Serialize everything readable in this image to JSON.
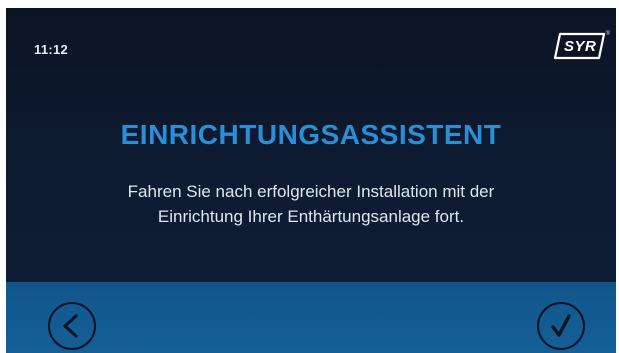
{
  "status_bar": {
    "time": "11:12",
    "logo_text": "SYR",
    "logo_mark": "®"
  },
  "wizard": {
    "title": "EINRICHTUNGSASSISTENT",
    "message_line1": "Fahren Sie nach erfolgreicher Installation mit der",
    "message_line2": "Einrichtung Ihrer Enthärtungsanlage fort."
  },
  "footer": {
    "back_icon": "chevron-left-icon",
    "confirm_icon": "checkmark-icon"
  },
  "colors": {
    "background": "#0e1a30",
    "title": "#2a8fd6",
    "footer": "#135c93",
    "text": "#dfe6ee"
  }
}
